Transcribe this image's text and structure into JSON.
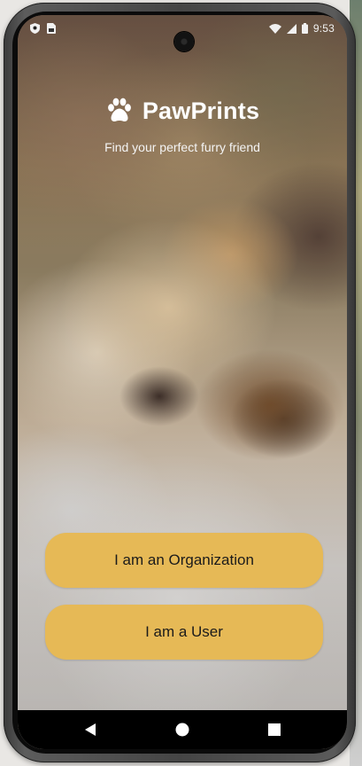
{
  "status_bar": {
    "time": "9:53",
    "left_icons": [
      "shield-icon",
      "sim-card-icon"
    ],
    "right_icons": [
      "wifi-icon",
      "signal-icon",
      "battery-icon"
    ]
  },
  "app": {
    "title": "PawPrints",
    "tagline": "Find your perfect furry friend",
    "logo_icon": "paw-icon"
  },
  "actions": {
    "organization_label": "I am an Organization",
    "user_label": "I am a User"
  },
  "nav_bar": {
    "buttons": [
      "back-icon",
      "home-icon",
      "recents-icon"
    ]
  },
  "colors": {
    "button_bg": "#e6b956",
    "button_text": "#1b1b1b",
    "title_text": "#ffffff"
  }
}
